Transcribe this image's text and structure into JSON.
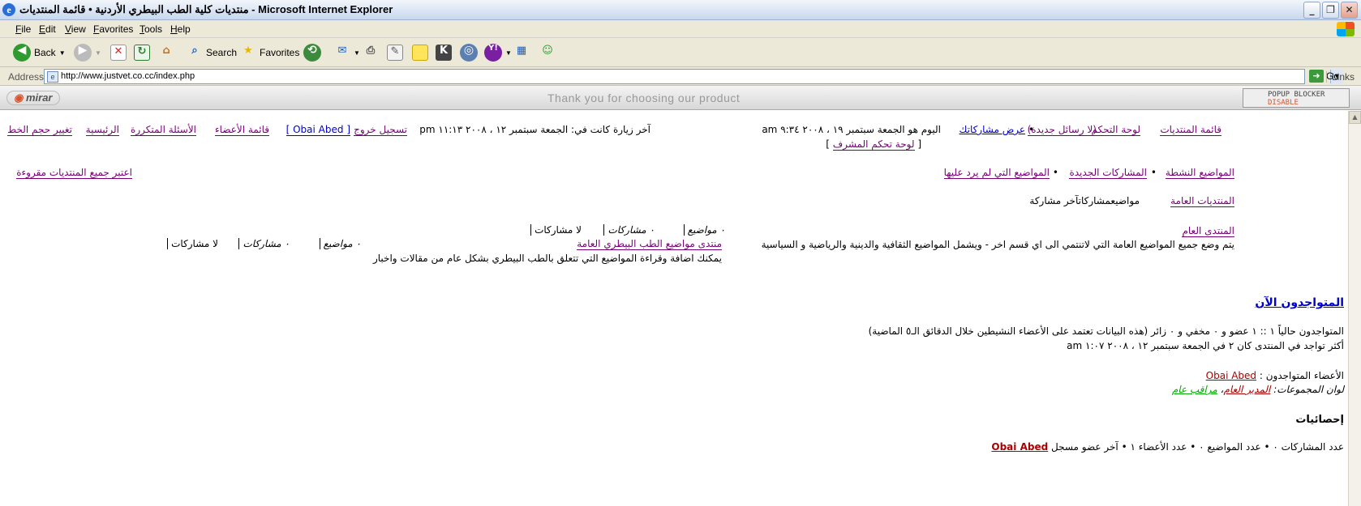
{
  "window": {
    "title": "منتديات كلية الطب البيطري الأردنية • قائمة المنتديات - Microsoft Internet Explorer",
    "buttons": [
      "_",
      "❐",
      "✕"
    ]
  },
  "menu": [
    "File",
    "Edit",
    "View",
    "Favorites",
    "Tools",
    "Help"
  ],
  "toolbar": {
    "back": "Back",
    "search": "Search",
    "favorites": "Favorites"
  },
  "address": {
    "label": "Address",
    "url": "http://www.justvet.co.cc/index.php",
    "go": "Go",
    "links": "Links"
  },
  "extbar": {
    "brand": "mirar",
    "message": "Thank you for choosing our product",
    "popup_title": "POPUP BLOCKER",
    "popup_state": "DISABLE"
  },
  "top_nav": {
    "forums_list": "قائمة المنتديات",
    "control_panel": "لوحة التحكم",
    "new_messages": "(لا رسائل جديدة)",
    "view_posts": "عرض مشاركاتك",
    "sep": "•",
    "today": "اليوم هو الجمعة سبتمبر ١٩ ، ٢٠٠٨ ٩:٣٤ am",
    "admin_panel": "لوحة تحكم المشرف",
    "last_visit": "آخر زيارة كانت في: الجمعة سبتمبر ١٢ ، ٢٠٠٨ ١١:١٣ pm",
    "logout": "تسجيل خروج",
    "user": "[ Obai Abed ]",
    "members": "قائمة الأعضاء",
    "faq": "الأسئلة المتكررة",
    "home": "الرئيسية",
    "font_size": "تغيير حجم الخط"
  },
  "search_links": {
    "active": "المواضيع النشطة",
    "new_posts": "المشاركات الجديدة",
    "unanswered": "المواضيع التي لم يرد عليها",
    "mark_read": "اعتبر جميع المنتديات مقروءة"
  },
  "category": {
    "name": "المنتديات العامة",
    "columns": "مواضيعمشاركاتآخر مشاركة"
  },
  "forums": [
    {
      "name": "المنتدى العام",
      "desc": "يتم وضع جميع المواضيع العامة التي لاتنتمي الى اي قسم اخر - ويشمل المواضيع الثقافية والدينية والرياضية و السياسية",
      "topics": "٠ مواضيع",
      "posts": "٠ مشاركات",
      "last": "لا مشاركات"
    },
    {
      "name": "منتدى مواضيع الطب البيطري العامة",
      "desc": "يمكنك اضافة وقراءة المواضيع التي تتعلق بالطب البيطري بشكل عام من مقالات واخبار",
      "topics": "٠ مواضيع",
      "posts": "٠ مشاركات",
      "last": "لا مشاركات"
    }
  ],
  "online": {
    "header": "المتواجدون الآن",
    "line1": "المتواجدون حالياً ١ :: ١ عضو و ٠ مخفي و ٠ زائر (هذه البيانات تعتمد على الأعضاء النشيطين خلال الدقائق الـ٥ الماضية)",
    "line2": "أكثر تواجد في المنتدى كان ٢ في الجمعة سبتمبر ١٢ ، ٢٠٠٨ ١:٠٧ am",
    "members_label": "الأعضاء المتواجدون :",
    "member": "Obai Abed",
    "groups_label": "لوان المجموعات:",
    "group_admin": "المدير العام",
    "group_mod": "مراقب عام",
    "group_sep": "،"
  },
  "stats": {
    "header": "إحصائيات",
    "line": "عدد المشاركات ٠ • عدد المواضيع ٠ • عدد الأعضاء ١ • آخر عضو مسجل",
    "newest": "Obai Abed"
  }
}
